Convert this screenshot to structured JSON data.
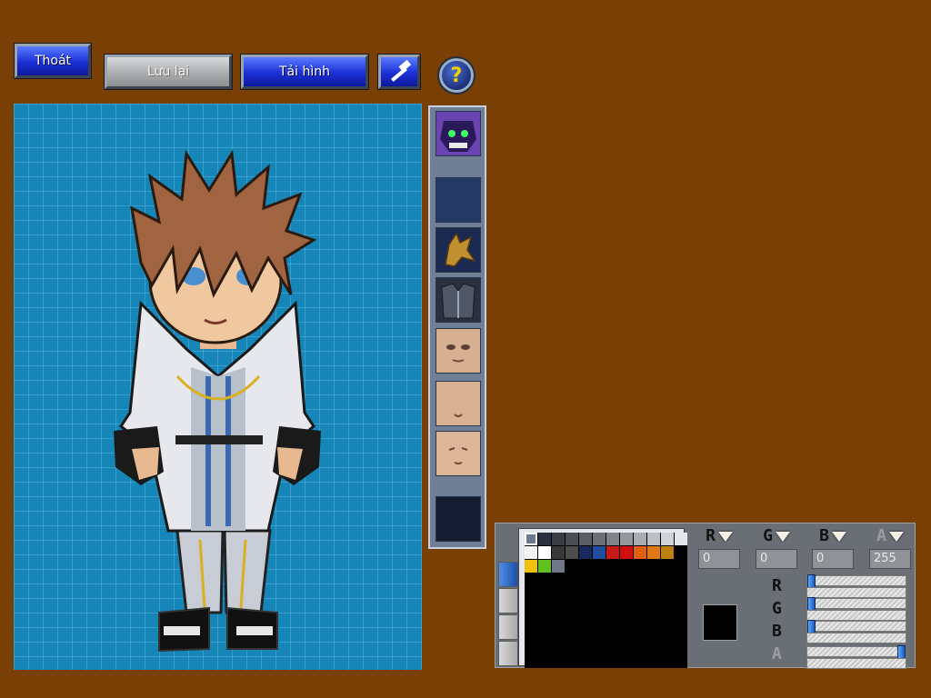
{
  "toolbar": {
    "exit_label": "Thoát",
    "save_label": "Lưu lại",
    "load_label": "Tải hình",
    "help_label": "?"
  },
  "parts_strip": {
    "slots": [
      {
        "name": "monster-head",
        "filled": true
      },
      {
        "name": "empty",
        "filled": false
      },
      {
        "name": "dragon-head",
        "filled": true
      },
      {
        "name": "armor-body",
        "filled": true
      },
      {
        "name": "face-1",
        "filled": true
      },
      {
        "name": "face-2",
        "filled": true
      },
      {
        "name": "face-3",
        "filled": true
      },
      {
        "name": "empty",
        "filled": false
      }
    ]
  },
  "color_panel": {
    "palette": [
      "#6d7a8e",
      "#2a3040",
      "#383c44",
      "#4a4e56",
      "#5a5e66",
      "#6c7078",
      "#808488",
      "#94989c",
      "#a8acb0",
      "#bcc0c4",
      "#d0d4d8",
      "#e4e6e8",
      "#f2f2f2",
      "#ffffff",
      "#383838",
      "#4c4c4c",
      "#1a2a5a",
      "#1f4ea0",
      "#c81818",
      "#d01010",
      "#e06010",
      "#e07818",
      "#c08010",
      "#000000",
      "#f0c010",
      "#60c020",
      "#707888",
      "#000000",
      "#000000",
      "#000000",
      "#000000",
      "#000000",
      "#000000",
      "#000000",
      "#000000",
      "#000000"
    ],
    "channels": [
      {
        "name": "R",
        "value": "0"
      },
      {
        "name": "G",
        "value": "0"
      },
      {
        "name": "B",
        "value": "0"
      },
      {
        "name": "A",
        "value": "255"
      }
    ],
    "sliders": [
      {
        "name": "R",
        "level": 0.0
      },
      {
        "name": "G",
        "level": 0.0
      },
      {
        "name": "B",
        "level": 0.0
      },
      {
        "name": "A",
        "level": 1.0
      }
    ],
    "current_color": "#000000"
  },
  "colors": {
    "background": "#7a3f05",
    "canvas": "#1686b8",
    "accent_blue": "#1a2fd6"
  }
}
